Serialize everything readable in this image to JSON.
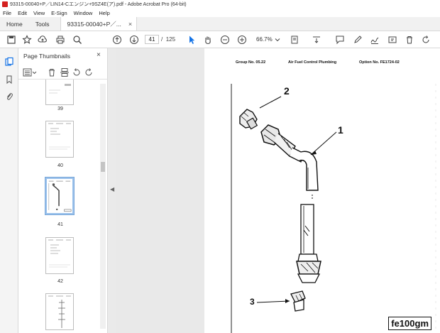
{
  "window": {
    "title": "93315-00040+P／LIN14-Cエンジン+9SZ4E(ア).pdf - Adobe Acrobat Pro (64-bit)"
  },
  "menu": [
    "File",
    "Edit",
    "View",
    "E-Sign",
    "Window",
    "Help"
  ],
  "tabs": {
    "home": "Home",
    "tools": "Tools",
    "document": "93315-00040+P／...",
    "close": "×"
  },
  "toolbar": {
    "current_page": "41",
    "page_separator": "/",
    "total_pages": "125",
    "zoom": "66.7%"
  },
  "thumbnails": {
    "title": "Page Thumbnails",
    "close": "×",
    "pages": [
      {
        "label": "39",
        "selected": false
      },
      {
        "label": "40",
        "selected": false
      },
      {
        "label": "41",
        "selected": true
      },
      {
        "label": "42",
        "selected": false
      },
      {
        "label": "",
        "selected": false
      }
    ]
  },
  "document": {
    "group": "Group No. 05.22",
    "section": "Air Fuel Control Plumbing",
    "option": "Option No. FE1724-02",
    "callouts": [
      "1",
      "2",
      "3"
    ],
    "figure_id": "fe100gm"
  },
  "colors": {
    "acrobat_red": "#d4201f",
    "selection_blue": "#1473e6"
  }
}
